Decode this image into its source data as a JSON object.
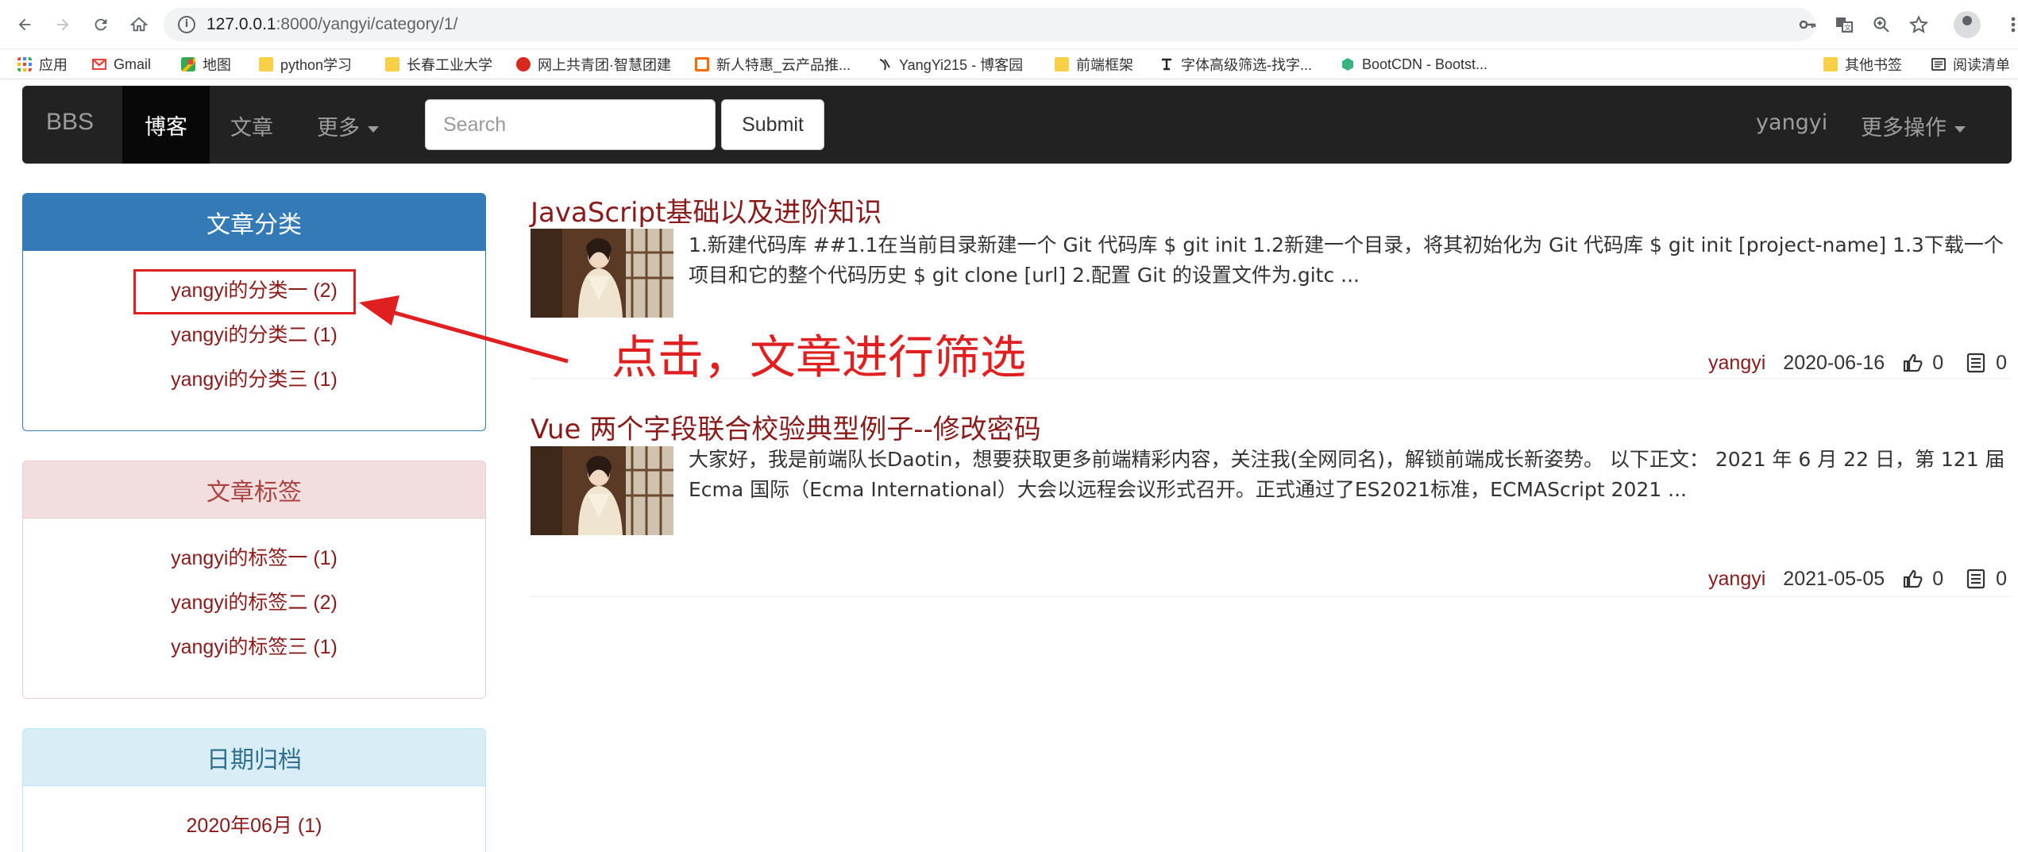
{
  "browser": {
    "url_host": "127.0.0.1",
    "url_path": ":8000/yangyi/category/1/",
    "bookmarks": [
      {
        "label": "应用",
        "icon": "apps-grid-icon"
      },
      {
        "label": "Gmail",
        "icon": "gmail-icon"
      },
      {
        "label": "地图",
        "icon": "maps-icon"
      },
      {
        "label": "python学习",
        "icon": "folder-icon"
      },
      {
        "label": "长春工业大学",
        "icon": "folder-icon"
      },
      {
        "label": "网上共青团·智慧团建",
        "icon": "site-icon"
      },
      {
        "label": "新人特惠_云产品推...",
        "icon": "site-icon"
      },
      {
        "label": "YangYi215 - 博客园",
        "icon": "site-icon"
      },
      {
        "label": "前端框架",
        "icon": "folder-icon"
      },
      {
        "label": "字体高级筛选-找字...",
        "icon": "site-icon"
      },
      {
        "label": "BootCDN - Bootst...",
        "icon": "site-icon"
      },
      {
        "label": "其他书签",
        "icon": "folder-icon"
      },
      {
        "label": "阅读清单",
        "icon": "reading-list-icon"
      }
    ]
  },
  "navbar": {
    "brand": "BBS",
    "active_item": "博客",
    "items": [
      "文章",
      "更多"
    ],
    "search_placeholder": "Search",
    "submit_label": "Submit",
    "user": "yangyi",
    "more_actions": "更多操作"
  },
  "sidebar": {
    "categories": {
      "title": "文章分类",
      "items": [
        "yangyi的分类一 (2)",
        "yangyi的分类二 (1)",
        "yangyi的分类三 (1)"
      ]
    },
    "tags": {
      "title": "文章标签",
      "items": [
        "yangyi的标签一 (1)",
        "yangyi的标签二 (2)",
        "yangyi的标签三 (1)"
      ]
    },
    "archive": {
      "title": "日期归档",
      "items": [
        "2020年06月 (1)"
      ]
    }
  },
  "articles": [
    {
      "title": "JavaScript基础以及进阶知识",
      "summary": "1.新建代码库 ##1.1在当前目录新建一个 Git 代码库 $ git init 1.2新建一个目录，将其初始化为 Git 代码库 $ git init [project-name] 1.3下载一个项目和它的整个代码历史 $ git clone [url] 2.配置 Git 的设置文件为.gitc ...",
      "author": "yangyi",
      "date": "2020-06-16",
      "likes": "0",
      "comments": "0"
    },
    {
      "title": "Vue 两个字段联合校验典型例子--修改密码",
      "summary": "大家好，我是前端队长Daotin，想要获取更多前端精彩内容，关注我(全网同名)，解锁前端成长新姿势。 以下正文： 2021 年 6 月 22 日，第 121 届 Ecma 国际（Ecma International）大会以远程会议形式召开。正式通过了ES2021标准，ECMAScript 2021 ...",
      "author": "yangyi",
      "date": "2021-05-05",
      "likes": "0",
      "comments": "0"
    }
  ],
  "annotation": {
    "text": "点击，文章进行筛选",
    "color": "#e02020"
  },
  "colors": {
    "link": "#8b1a1a",
    "navbar_bg": "#222222",
    "panel_primary": "#337ab7",
    "panel_danger_bg": "#f2dede",
    "panel_info_bg": "#d9edf7"
  }
}
